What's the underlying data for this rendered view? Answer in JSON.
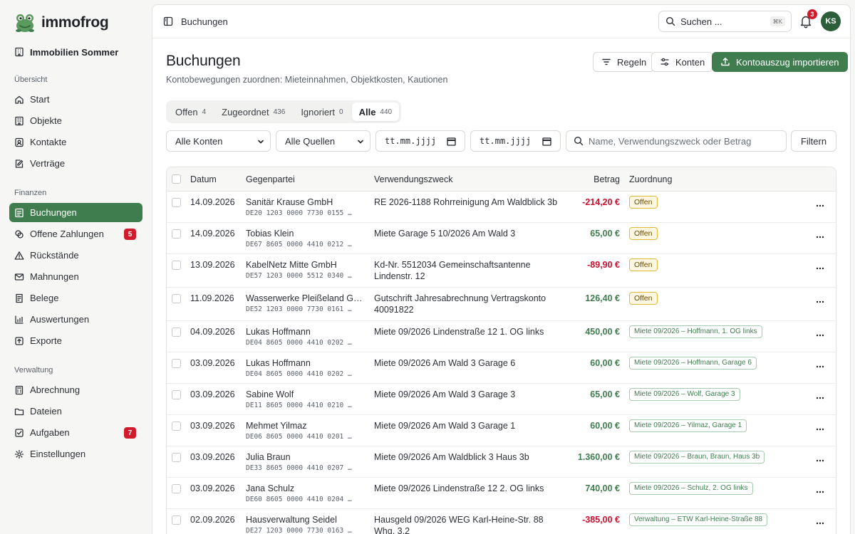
{
  "brand": {
    "name": "immofrog"
  },
  "org": {
    "name": "Immobilien Sommer"
  },
  "sidebar": {
    "sections": [
      {
        "label": "Übersicht",
        "items": [
          {
            "label": "Start",
            "icon": "home-icon"
          },
          {
            "label": "Objekte",
            "icon": "building-icon"
          },
          {
            "label": "Kontakte",
            "icon": "contacts-icon"
          },
          {
            "label": "Verträge",
            "icon": "contract-icon"
          }
        ]
      },
      {
        "label": "Finanzen",
        "items": [
          {
            "label": "Buchungen",
            "icon": "bookings-icon",
            "active": true
          },
          {
            "label": "Offene Zahlungen",
            "icon": "payments-icon",
            "badge": "5"
          },
          {
            "label": "Rückstände",
            "icon": "warning-icon"
          },
          {
            "label": "Mahnungen",
            "icon": "mail-icon"
          },
          {
            "label": "Belege",
            "icon": "receipt-icon"
          },
          {
            "label": "Auswertungen",
            "icon": "chart-icon"
          },
          {
            "label": "Exporte",
            "icon": "export-icon"
          }
        ]
      },
      {
        "label": "Verwaltung",
        "items": [
          {
            "label": "Abrechnung",
            "icon": "calculator-icon"
          },
          {
            "label": "Dateien",
            "icon": "folder-icon"
          },
          {
            "label": "Aufgaben",
            "icon": "checkbox-icon",
            "badge": "7"
          },
          {
            "label": "Einstellungen",
            "icon": "gear-icon"
          }
        ]
      }
    ]
  },
  "topbar": {
    "breadcrumb": "Buchungen",
    "search_label": "Suchen ...",
    "search_shortcut": "⌘K",
    "notification_count": "3",
    "avatar_initials": "KS"
  },
  "page": {
    "title": "Buchungen",
    "subtitle": "Kontobewegungen zuordnen: Mieteinnahmen, Objektkosten, Kautionen",
    "btn_rules": "Regeln",
    "btn_accounts": "Konten",
    "btn_import": "Kontoauszug importieren"
  },
  "tabs": [
    {
      "label": "Offen",
      "count": "4",
      "active": false
    },
    {
      "label": "Zugeordnet",
      "count": "436",
      "active": false
    },
    {
      "label": "Ignoriert",
      "count": "0",
      "active": false
    },
    {
      "label": "Alle",
      "count": "440",
      "active": true
    }
  ],
  "filters": {
    "account": "Alle Konten",
    "source": "Alle Quellen",
    "date_from": "tt.mm.jjjj",
    "date_to": "tt.mm.jjjj",
    "search_placeholder": "Name, Verwendungszweck oder Betrag",
    "filter_button": "Filtern"
  },
  "table": {
    "headers": {
      "date": "Datum",
      "party": "Gegenpartei",
      "purpose": "Verwendungszweck",
      "amount": "Betrag",
      "assignment": "Zuordnung"
    },
    "rows": [
      {
        "date": "14.09.2026",
        "party": "Sanitär Krause GmbH",
        "iban": "DE20 1203 0000 7730 0155 …",
        "purpose": "RE 2026-1188 Rohrreinigung Am Waldblick 3b",
        "amount": "-214,20 €",
        "sign": "neg",
        "status": "open",
        "assignment": "Offen"
      },
      {
        "date": "14.09.2026",
        "party": "Tobias Klein",
        "iban": "DE67 8605 0000 4410 0212 …",
        "purpose": "Miete Garage 5 10/2026 Am Wald 3",
        "amount": "65,00 €",
        "sign": "pos",
        "status": "open",
        "assignment": "Offen"
      },
      {
        "date": "13.09.2026",
        "party": "KabelNetz Mitte GmbH",
        "iban": "DE57 1203 0000 5512 0340 …",
        "purpose": "Kd-Nr. 5512034 Gemeinschaftsantenne Lindenstr. 12",
        "amount": "-89,90 €",
        "sign": "neg",
        "status": "open",
        "assignment": "Offen"
      },
      {
        "date": "11.09.2026",
        "party": "Wasserwerke Pleißeland Gm…",
        "iban": "DE52 1203 0000 7730 0161 …",
        "purpose": "Gutschrift Jahresabrechnung Vertragskonto 40091822",
        "amount": "126,40 €",
        "sign": "pos",
        "status": "open",
        "assignment": "Offen"
      },
      {
        "date": "04.09.2026",
        "party": "Lukas Hoffmann",
        "iban": "DE04 8605 0000 4410 0202 …",
        "purpose": "Miete 09/2026 Lindenstraße 12 1. OG links",
        "amount": "450,00 €",
        "sign": "pos",
        "status": "assigned",
        "assignment": "Miete 09/2026 – Hoffmann, 1. OG links"
      },
      {
        "date": "03.09.2026",
        "party": "Lukas Hoffmann",
        "iban": "DE04 8605 0000 4410 0202 …",
        "purpose": "Miete 09/2026 Am Wald 3 Garage 6",
        "amount": "60,00 €",
        "sign": "pos",
        "status": "assigned",
        "assignment": "Miete 09/2026 – Hoffmann, Garage 6"
      },
      {
        "date": "03.09.2026",
        "party": "Sabine Wolf",
        "iban": "DE11 8605 0000 4410 0210 …",
        "purpose": "Miete 09/2026 Am Wald 3 Garage 3",
        "amount": "65,00 €",
        "sign": "pos",
        "status": "assigned",
        "assignment": "Miete 09/2026 – Wolf, Garage 3"
      },
      {
        "date": "03.09.2026",
        "party": "Mehmet Yilmaz",
        "iban": "DE06 8605 0000 4410 0201 …",
        "purpose": "Miete 09/2026 Am Wald 3 Garage 1",
        "amount": "60,00 €",
        "sign": "pos",
        "status": "assigned",
        "assignment": "Miete 09/2026 – Yilmaz, Garage 1"
      },
      {
        "date": "03.09.2026",
        "party": "Julia Braun",
        "iban": "DE33 8605 0000 4410 0207 …",
        "purpose": "Miete 09/2026 Am Waldblick 3 Haus 3b",
        "amount": "1.360,00 €",
        "sign": "pos",
        "status": "assigned",
        "assignment": "Miete 09/2026 – Braun, Braun, Haus 3b"
      },
      {
        "date": "03.09.2026",
        "party": "Jana Schulz",
        "iban": "DE60 8605 0000 4410 0204 …",
        "purpose": "Miete 09/2026 Lindenstraße 12 2. OG links",
        "amount": "740,00 €",
        "sign": "pos",
        "status": "assigned",
        "assignment": "Miete 09/2026 – Schulz, 2. OG links"
      },
      {
        "date": "02.09.2026",
        "party": "Hausverwaltung Seidel",
        "iban": "DE27 1203 0000 7730 0163 …",
        "purpose": "Hausgeld 09/2026 WEG Karl-Heine-Str. 88 Whg. 3.2",
        "amount": "-385,00 €",
        "sign": "neg",
        "status": "assigned",
        "assignment": "Verwaltung – ETW Karl-Heine-Straße 88"
      }
    ]
  },
  "colors": {
    "accent": "#3f7d4e",
    "negative": "#c8102e",
    "badge": "#d11b2d",
    "open_bg": "#fdf7e2",
    "open_border": "#e3b93a"
  }
}
